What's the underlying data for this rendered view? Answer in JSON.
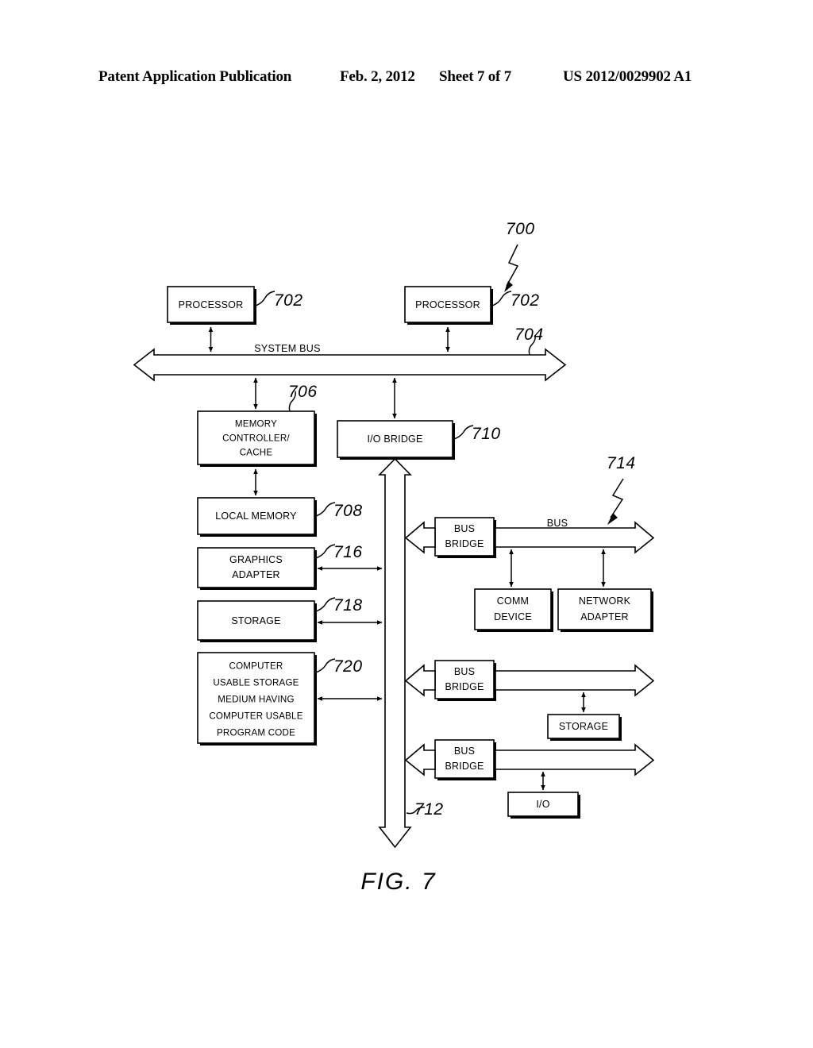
{
  "header": {
    "publication": "Patent Application Publication",
    "date": "Feb. 2, 2012",
    "sheet": "Sheet 7 of 7",
    "number": "US 2012/0029902 A1"
  },
  "figure": {
    "caption": "FIG. 7",
    "system_ref": "700"
  },
  "blocks": {
    "processor_left": {
      "label": "PROCESSOR",
      "ref": "702"
    },
    "processor_right": {
      "label": "PROCESSOR",
      "ref": "702"
    },
    "memory_controller": {
      "line1": "MEMORY",
      "line2": "CONTROLLER/",
      "line3": "CACHE",
      "ref": "706"
    },
    "io_bridge": {
      "label": "I/O BRIDGE",
      "ref": "710"
    },
    "local_memory": {
      "label": "LOCAL MEMORY",
      "ref": "708"
    },
    "graphics_adapter": {
      "line1": "GRAPHICS",
      "line2": "ADAPTER",
      "ref": "716"
    },
    "storage_left": {
      "label": "STORAGE",
      "ref": "718"
    },
    "computer_usable_medium": {
      "line1": "COMPUTER",
      "line2": "USABLE STORAGE",
      "line3": "MEDIUM HAVING",
      "line4": "COMPUTER USABLE",
      "line5": "PROGRAM CODE",
      "ref": "720"
    },
    "bus_bridge_1": {
      "line1": "BUS",
      "line2": "BRIDGE"
    },
    "bus_bridge_2": {
      "line1": "BUS",
      "line2": "BRIDGE"
    },
    "bus_bridge_3": {
      "line1": "BUS",
      "line2": "BRIDGE"
    },
    "comm_device": {
      "line1": "COMM",
      "line2": "DEVICE"
    },
    "network_adapter": {
      "line1": "NETWORK",
      "line2": "ADAPTER"
    },
    "storage_right": {
      "label": "STORAGE"
    },
    "io_device": {
      "label": "I/O"
    }
  },
  "buses": {
    "system_bus": {
      "label": "SYSTEM BUS",
      "ref": "704"
    },
    "io_bus": {
      "ref": "712"
    },
    "peripheral_bus": {
      "label": "BUS",
      "ref": "714"
    }
  }
}
